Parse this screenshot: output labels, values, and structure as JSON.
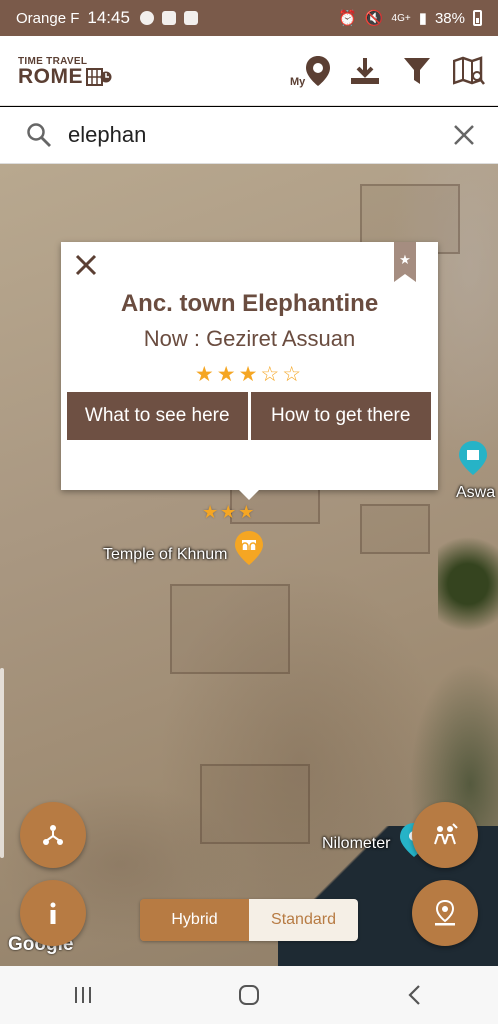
{
  "status_bar": {
    "carrier": "Orange F",
    "time": "14:45",
    "network": "4G+",
    "battery": "38%"
  },
  "app": {
    "logo_small": "TIME TRAVEL",
    "logo_big": "ROME",
    "my_label": "My"
  },
  "search": {
    "query": "elephan"
  },
  "popup": {
    "title": "Anc. town Elephantine",
    "subtitle": "Now :  Geziret Assuan",
    "rating": 3,
    "rating_max": 5,
    "rating_stars": "★★★☆☆",
    "buttons": {
      "what_to_see": "What to see here",
      "how_to_get": "How to get there"
    }
  },
  "map": {
    "pois": {
      "temple": {
        "label": "Temple of Khnum",
        "stars": "★★★"
      },
      "nilometer": {
        "label": "Nilometer"
      },
      "aswan": {
        "label": "Aswa"
      }
    },
    "attribution": "Google",
    "map_type": {
      "hybrid": "Hybrid",
      "standard": "Standard",
      "selected": "Hybrid"
    }
  },
  "colors": {
    "brand_brown": "#6e5043",
    "accent_orange": "#b77b43",
    "star": "#f5a623",
    "status_bar": "#7a5a4a"
  }
}
